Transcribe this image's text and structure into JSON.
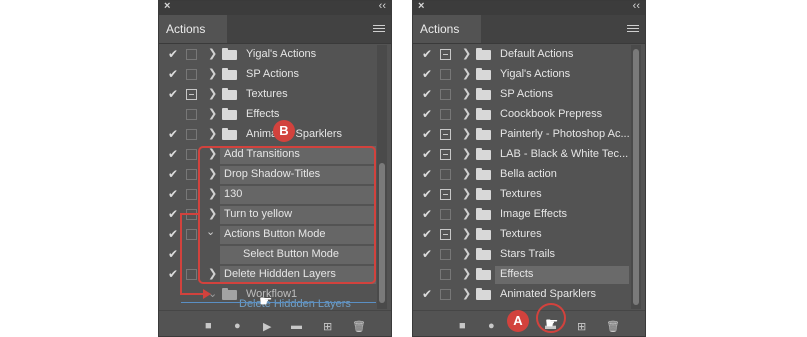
{
  "panel_title": "Actions",
  "close_glyph": "×",
  "collapse_glyph": "‹‹",
  "check_glyph": "✔",
  "left_panel": {
    "rows": [
      {
        "type": "set",
        "label": "Yigal's Actions",
        "checked": true,
        "dialog": false
      },
      {
        "type": "set",
        "label": "SP Actions",
        "checked": true,
        "dialog": false
      },
      {
        "type": "set",
        "label": "Textures",
        "checked": true,
        "dialog": true
      },
      {
        "type": "set",
        "label": "Effects",
        "checked": false,
        "dialog": false
      },
      {
        "type": "set",
        "label": "Animated Sparklers",
        "checked": true,
        "dialog": false
      },
      {
        "type": "action",
        "label": "Add Transitions",
        "checked": true,
        "dialog": false
      },
      {
        "type": "action",
        "label": "Drop Shadow-Titles",
        "checked": true,
        "dialog": false
      },
      {
        "type": "action",
        "label": "130",
        "checked": true,
        "dialog": false
      },
      {
        "type": "action",
        "label": "Turn to yellow",
        "checked": true,
        "dialog": false
      },
      {
        "type": "action",
        "label": "Actions Button Mode",
        "checked": true,
        "dialog": false,
        "open": true
      },
      {
        "type": "step",
        "label": "Select Button Mode",
        "checked": true
      },
      {
        "type": "action",
        "label": "Delete Hiddden Layers",
        "checked": true,
        "dialog": false
      },
      {
        "type": "dragset",
        "label": "Workflow1"
      }
    ],
    "drag_ghost_label": "Delete Hiddden Layers",
    "badge": "B"
  },
  "right_panel": {
    "rows": [
      {
        "type": "set",
        "label": "Default Actions",
        "checked": true,
        "dialog": true
      },
      {
        "type": "set",
        "label": "Yigal's Actions",
        "checked": true,
        "dialog": false
      },
      {
        "type": "set",
        "label": "SP Actions",
        "checked": true,
        "dialog": false
      },
      {
        "type": "set",
        "label": "Coockbook Prepress",
        "checked": true,
        "dialog": false
      },
      {
        "type": "set",
        "label": "Painterly - Photoshop Ac...",
        "checked": true,
        "dialog": true
      },
      {
        "type": "set",
        "label": "LAB - Black & White Tec...",
        "checked": true,
        "dialog": true
      },
      {
        "type": "set",
        "label": "Bella action",
        "checked": true,
        "dialog": false
      },
      {
        "type": "set",
        "label": "Textures",
        "checked": true,
        "dialog": true
      },
      {
        "type": "set",
        "label": "Image Effects",
        "checked": true,
        "dialog": false
      },
      {
        "type": "set",
        "label": "Textures",
        "checked": true,
        "dialog": true
      },
      {
        "type": "set",
        "label": "Stars Trails",
        "checked": true,
        "dialog": false
      },
      {
        "type": "set",
        "label": "Effects",
        "checked": false,
        "dialog": false,
        "selected": true
      },
      {
        "type": "set",
        "label": "Animated Sparklers",
        "checked": true,
        "dialog": false
      }
    ],
    "badge": "A"
  },
  "bottom_icons": [
    {
      "name": "stop-icon",
      "glyph": "■"
    },
    {
      "name": "record-icon",
      "glyph": "●"
    },
    {
      "name": "play-icon",
      "glyph": "▶"
    },
    {
      "name": "new-set-icon",
      "glyph": "▬"
    },
    {
      "name": "new-action-icon",
      "glyph": "⊞"
    },
    {
      "name": "trash-icon",
      "glyph": "🗑"
    }
  ],
  "accent_red": "#d2423d"
}
